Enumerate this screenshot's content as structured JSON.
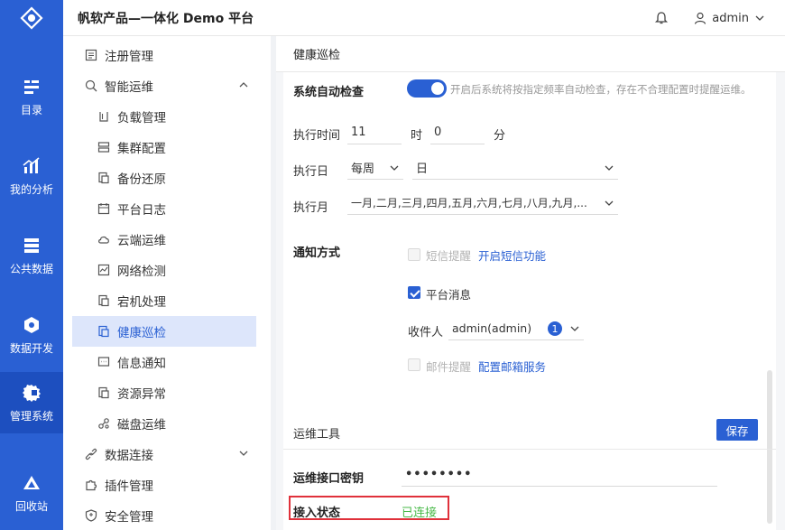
{
  "header": {
    "title": "帆软产品—一体化 Demo 平台",
    "user": "admin"
  },
  "rail": {
    "items": [
      {
        "label": "目录",
        "icon": "catalog-icon"
      },
      {
        "label": "我的分析",
        "icon": "analysis-icon"
      },
      {
        "label": "公共数据",
        "icon": "public-data-icon"
      },
      {
        "label": "数据开发",
        "icon": "data-dev-icon"
      },
      {
        "label": "管理系统",
        "icon": "admin-system-icon",
        "active": true
      },
      {
        "label": "回收站",
        "icon": "recycle-bin-icon"
      }
    ]
  },
  "sidebar": {
    "items": [
      {
        "label": "注册管理",
        "level": 1
      },
      {
        "label": "智能运维",
        "level": 1,
        "expanded": true
      },
      {
        "label": "负载管理",
        "level": 2
      },
      {
        "label": "集群配置",
        "level": 2
      },
      {
        "label": "备份还原",
        "level": 2
      },
      {
        "label": "平台日志",
        "level": 2
      },
      {
        "label": "云端运维",
        "level": 2
      },
      {
        "label": "网络检测",
        "level": 2
      },
      {
        "label": "宕机处理",
        "level": 2
      },
      {
        "label": "健康巡检",
        "level": 2,
        "active": true
      },
      {
        "label": "信息通知",
        "level": 2
      },
      {
        "label": "资源异常",
        "level": 2
      },
      {
        "label": "磁盘运维",
        "level": 2
      },
      {
        "label": "数据连接",
        "level": 1,
        "expanded": false
      },
      {
        "label": "插件管理",
        "level": 1
      },
      {
        "label": "安全管理",
        "level": 1
      }
    ]
  },
  "page": {
    "title": "健康巡检",
    "auto_check": {
      "label": "系统自动检查",
      "enabled": true,
      "hint": "开启后系统将按指定频率自动检查，存在不合理配置时提醒运维。"
    },
    "exec_time": {
      "label": "执行时间",
      "hour": "11",
      "hour_unit": "时",
      "minute": "0",
      "minute_unit": "分"
    },
    "exec_day": {
      "label": "执行日",
      "period": "每周",
      "day": "日"
    },
    "exec_month": {
      "label": "执行月",
      "months": "一月,二月,三月,四月,五月,六月,七月,八月,九月,..."
    },
    "notify": {
      "label": "通知方式",
      "sms": {
        "label": "短信提醒",
        "checked": false,
        "link": "开启短信功能"
      },
      "platform": {
        "label": "平台消息",
        "checked": true
      },
      "recipient": {
        "label": "收件人",
        "value": "admin(admin)",
        "count": "1"
      },
      "email": {
        "label": "邮件提醒",
        "checked": false,
        "link": "配置邮箱服务"
      }
    }
  },
  "ops_tools": {
    "title": "运维工具",
    "save_label": "保存",
    "key_label": "运维接口密钥",
    "key_value": "••••••••",
    "status_label": "接入状态",
    "status_value": "已连接"
  },
  "colors": {
    "accent": "#2a60d3",
    "rail": "#2a60d3",
    "connected": "#47b947",
    "highlight_border": "#e0313b"
  }
}
